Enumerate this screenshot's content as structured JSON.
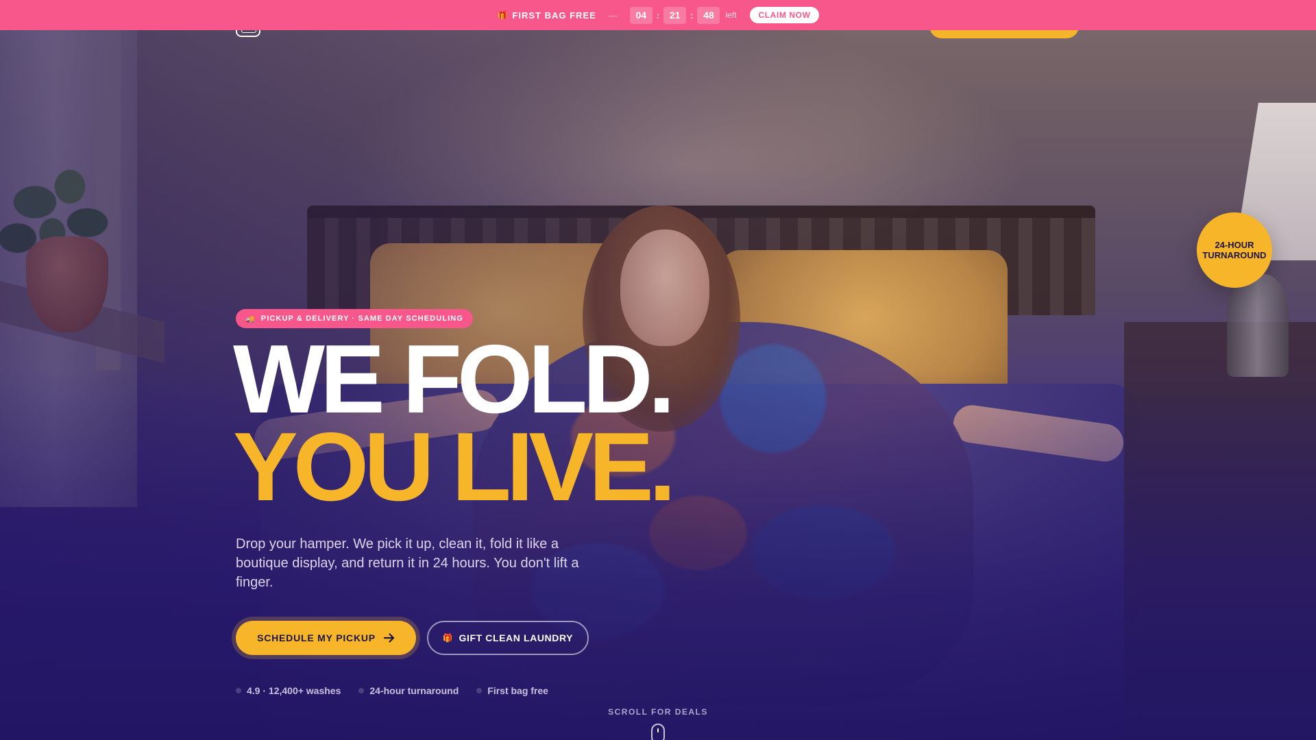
{
  "promo": {
    "gift_icon": "gift-icon",
    "tag": "FIRST BAG FREE",
    "dash": "—",
    "timer": {
      "hours": "04",
      "minutes": "21",
      "seconds": "48",
      "sep": ":"
    },
    "left_label": "left",
    "claim_label": "CLAIM NOW"
  },
  "hero": {
    "eyebrow_icon": "truck-icon",
    "eyebrow": "PICKUP & DELIVERY · SAME DAY SCHEDULING",
    "headline_line1": "WE FOLD.",
    "headline_line2": "YOU LIVE.",
    "subcopy": "Drop your hamper. We pick it up, clean it, fold it like a boutique display, and return it in 24 hours. You don't lift a finger.",
    "primary_cta": "SCHEDULE MY PICKUP",
    "secondary_cta": "GIFT CLEAN LAUNDRY",
    "proof": [
      "4.9 · 12,400+ washes",
      "24-hour turnaround",
      "First bag free"
    ],
    "scroll_label": "SCROLL FOR DEALS",
    "badge_line1": "24-HOUR",
    "badge_line2": "TURNAROUND"
  },
  "colors": {
    "promo_bg": "#f7578a",
    "accent_yellow": "#f7b62a",
    "hero_tint": "#2b1d6a"
  }
}
